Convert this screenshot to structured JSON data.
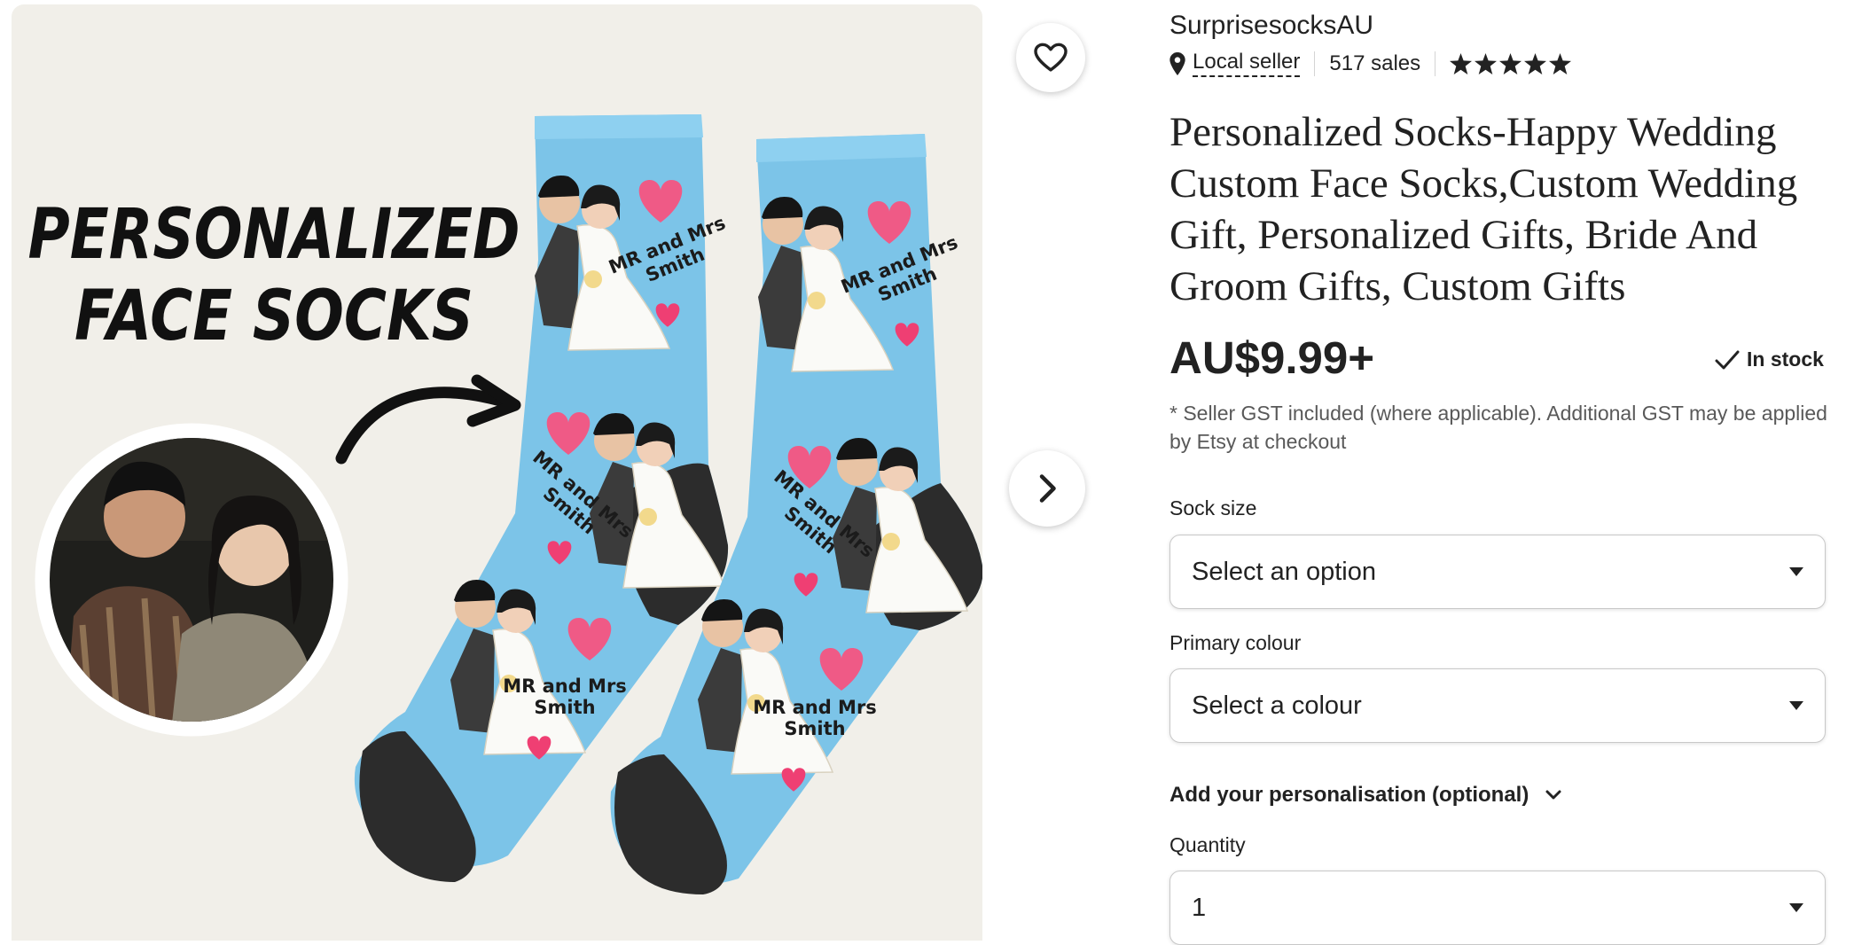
{
  "gallery": {
    "headline_line1": "PERSONALIZED",
    "headline_line2": "FACE SOCKS",
    "sock_text_line1": "MR and Mrs",
    "sock_text_line2": "Smith"
  },
  "shop": {
    "name": "SurprisesocksAU",
    "local_seller_label": "Local seller",
    "sales": "517 sales",
    "rating_stars": 5
  },
  "listing": {
    "title": "Personalized Socks-Happy Wedding Custom Face Socks,Custom Wedding Gift, Personalized Gifts, Bride And Groom Gifts, Custom Gifts",
    "price": "AU$9.99+",
    "stock_status": "In stock",
    "tax_note": "* Seller GST included (where applicable). Additional GST may be applied by Etsy at checkout"
  },
  "options": {
    "sock_size_label": "Sock size",
    "sock_size_value": "Select an option",
    "colour_label": "Primary colour",
    "colour_value": "Select a colour",
    "personalisation_label": "Add your personalisation (optional)",
    "quantity_label": "Quantity",
    "quantity_value": "1"
  },
  "colors": {
    "sock_blue": "#7cc4e8",
    "sock_dark": "#2c2c2c",
    "heart_pink": "#ef5a86",
    "gallery_bg": "#f1efe9"
  },
  "icons": [
    "heart-icon",
    "chevron-right-icon",
    "location-pin-icon",
    "star-icon",
    "checkmark-icon",
    "caret-down-icon",
    "chevron-down-icon"
  ]
}
